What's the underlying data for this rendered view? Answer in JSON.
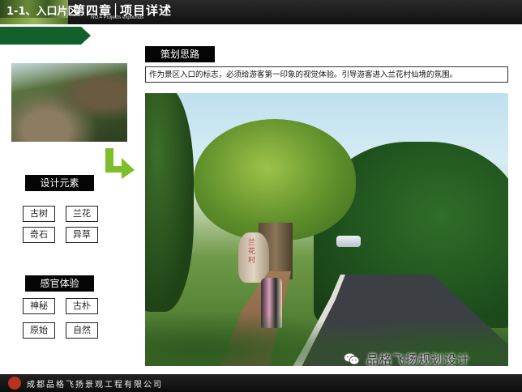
{
  "header": {
    "chapter_title": "第四章│项目详述",
    "chapter_subtitle": "NO.4 Projects expounds"
  },
  "section": {
    "label": "1-1、入口片区"
  },
  "strategy": {
    "heading": "策划思路",
    "description": "作为景区入口的标志，必须给游客第一印象的视觉体验。引导游客进入兰花村仙境的氛围。"
  },
  "design_elements": {
    "heading": "设计元素",
    "items": [
      "古树",
      "兰花",
      "奇石",
      "异草"
    ]
  },
  "sensory_experience": {
    "heading": "感官体验",
    "items": [
      "神秘",
      "古朴",
      "原始",
      "自然"
    ]
  },
  "rendering": {
    "stone_carving": "兰花村"
  },
  "watermark": {
    "text": "品格飞扬规划设计"
  },
  "footer": {
    "company": "成都品格飞扬景观工程有限公司"
  },
  "colors": {
    "section_green": "#13602c",
    "arrow_green": "#7cbf2a",
    "logo_red": "#b7321f"
  }
}
